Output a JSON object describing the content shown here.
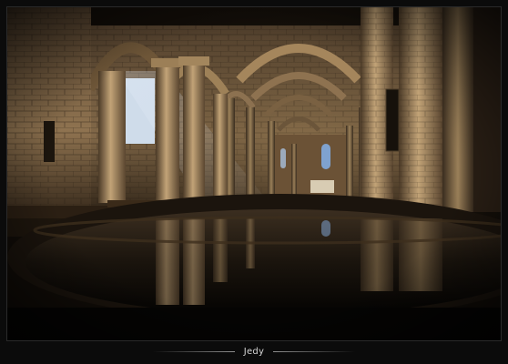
{
  "photo": {
    "subject": "romanesque-church-nave-with-font-reflection",
    "palette": {
      "stone_light": "#b89a6c",
      "stone_mid": "#7a6242",
      "stone_dark": "#2b2116",
      "light_beam": "#d9e6f5",
      "window_blue": "#7fa2cf",
      "shadow": "#050403"
    }
  },
  "caption": {
    "signature": "Jedy"
  }
}
